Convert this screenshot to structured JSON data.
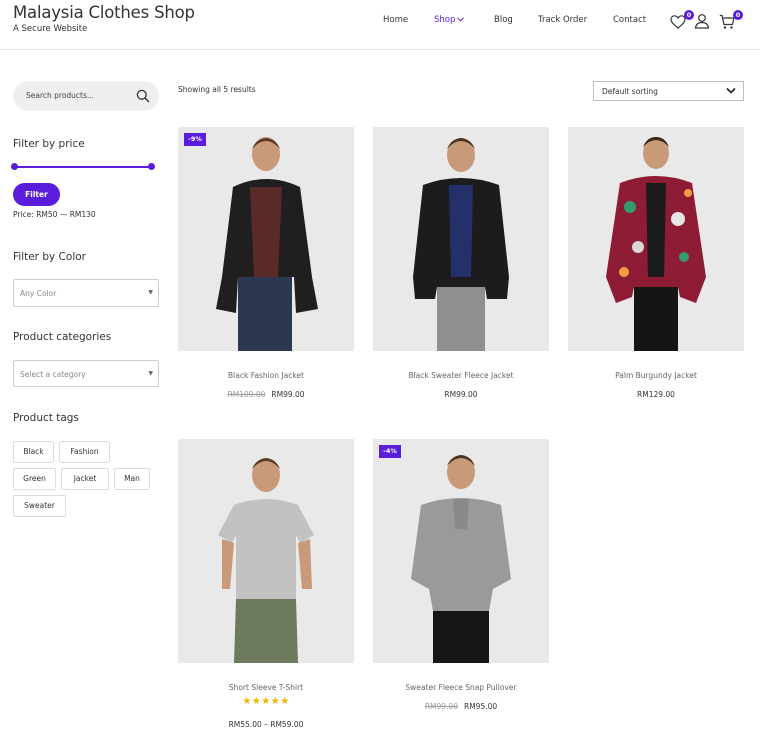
{
  "site": {
    "title": "Malaysia Clothes Shop",
    "tagline": "A Secure Website"
  },
  "nav": {
    "home": "Home",
    "shop": "Shop",
    "blog": "Blog",
    "track": "Track Order",
    "contact": "Contact"
  },
  "header_icons": {
    "wishlist_icon": "heart-icon",
    "wishlist_count": "0",
    "account_icon": "user-icon",
    "cart_icon": "cart-icon",
    "cart_count": "0"
  },
  "sidebar": {
    "search_placeholder": "Search products...",
    "price_heading": "Filter by price",
    "filter_button": "Filter",
    "price_label": "Price: RM50 — RM130",
    "color_heading": "Filter by Color",
    "color_select": "Any Color",
    "categories_heading": "Product categories",
    "category_select": "Select a category",
    "tags_heading": "Product tags",
    "tags": [
      "Black",
      "Fashion",
      "Green",
      "Jacket",
      "Man",
      "Sweater"
    ]
  },
  "main": {
    "result_count": "Showing all 5 results",
    "sorting": "Default sorting",
    "products": [
      {
        "name": "Black Fashion Jacket",
        "badge": "-9%",
        "old_price": "RM109.00",
        "price": "RM99.00"
      },
      {
        "name": "Black Sweater Fleece Jacket",
        "price": "RM99.00"
      },
      {
        "name": "Palm Burgundy Jacket",
        "price": "RM129.00"
      },
      {
        "name": "Short Sleeve T-Shirt",
        "rating": "5 of 5 stars",
        "stars": "★★★★★",
        "price": "RM55.00 – RM59.00"
      },
      {
        "name": "Sweater Fleece Snap Pullover",
        "badge": "-4%",
        "old_price": "RM99.00",
        "price": "RM95.00"
      }
    ]
  },
  "colors": {
    "accent": "#5a1ddb",
    "star": "#f0b400"
  }
}
